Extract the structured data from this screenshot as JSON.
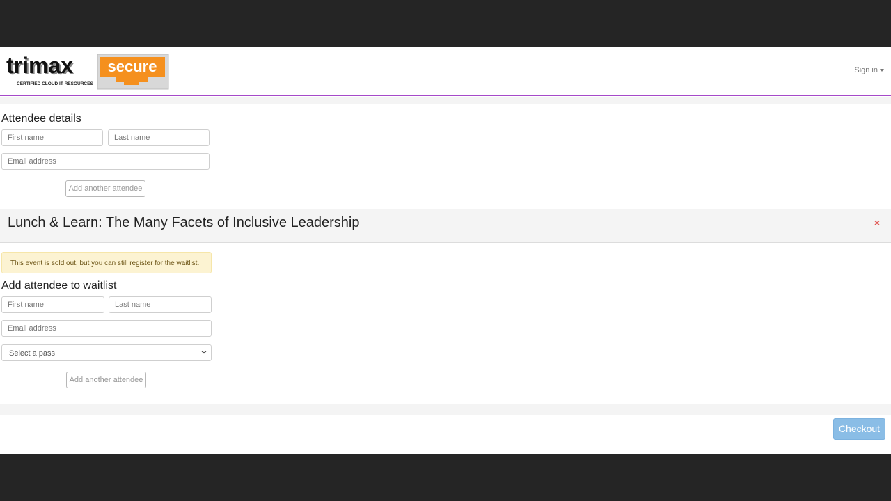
{
  "header": {
    "logo_text": "trimax",
    "logo_badge": "secure",
    "logo_tagline": "CERTIFIED CLOUD IT RESOURCES",
    "signin_label": "Sign in"
  },
  "attendee_section": {
    "title": "Attendee details",
    "first_name_placeholder": "First name",
    "last_name_placeholder": "Last name",
    "email_placeholder": "Email address",
    "add_button": "Add another attendee"
  },
  "event": {
    "title": "Lunch & Learn: The Many Facets of Inclusive Leadership",
    "close_label": "×",
    "alert": "This event is sold out, but you can still register for the waitlist."
  },
  "waitlist_section": {
    "title": "Add attendee to waitlist",
    "first_name_placeholder": "First name",
    "last_name_placeholder": "Last name",
    "email_placeholder": "Email address",
    "pass_select": "Select a pass",
    "add_button": "Add another attendee"
  },
  "footer": {
    "checkout_label": "Checkout"
  },
  "colors": {
    "header_border": "#a64ac9",
    "logo_orange": "#f5901e",
    "checkout_bg": "#8abde6",
    "alert_bg": "#fcf3d2",
    "close_red": "#e0534f"
  }
}
